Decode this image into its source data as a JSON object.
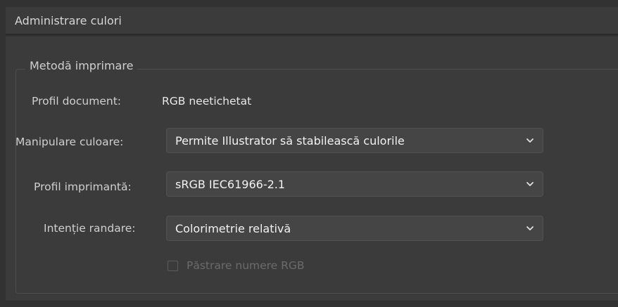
{
  "panel": {
    "title": "Administrare culori"
  },
  "group": {
    "legend": "Metodă imprimare"
  },
  "document_profile": {
    "label": "Profil document:",
    "value": "RGB neetichetat"
  },
  "color_handling": {
    "label": "Manipulare culoare:",
    "selected": "Permite Illustrator să stabilească culorile"
  },
  "printer_profile": {
    "label": "Profil imprimantă:",
    "selected": "sRGB IEC61966-2.1"
  },
  "rendering_intent": {
    "label": "Intenție randare:",
    "selected": "Colorimetrie relativă"
  },
  "preserve_rgb": {
    "label": "Păstrare numere RGB",
    "checked": false,
    "enabled": false
  },
  "icons": {
    "dropdown": "chevron-down-icon"
  },
  "colors": {
    "background": "#323232",
    "panel": "#3b3b3b",
    "control": "#454545",
    "text": "#cfcfcf",
    "disabled_text": "#6b6b6b"
  }
}
